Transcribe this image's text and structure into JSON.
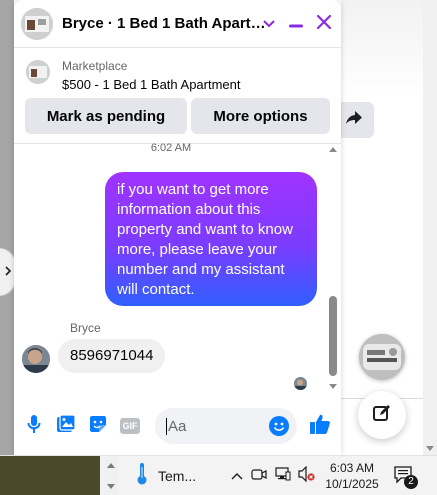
{
  "chat_window": {
    "header": {
      "title": "Bryce · 1 Bed 1 Bath Apart…",
      "icons": [
        "chevron-down-icon",
        "minimize-icon",
        "close-icon"
      ]
    },
    "marketplace": {
      "label": "Marketplace",
      "listing_title": "$500 - 1 Bed 1 Bath Apartment"
    },
    "actions": {
      "mark_pending_label": "Mark as pending",
      "more_options_label": "More options"
    },
    "timestamp": "6:02 AM",
    "messages": [
      {
        "direction": "outgoing",
        "text": "if you want to get more information about this property and want to know more, please leave your number and my assistant will contact."
      },
      {
        "direction": "incoming",
        "sender": "Bryce",
        "text": "8596971044"
      }
    ],
    "composer": {
      "placeholder": "Aa",
      "icons": [
        "microphone-icon",
        "photo-icon",
        "sticker-icon",
        "gif-icon",
        "emoji-icon",
        "thumbs-up-icon"
      ],
      "gif_label": "GIF"
    },
    "colors": {
      "accent": "#0a7cff",
      "header_icons": "#8a2be2",
      "bubble_gradient_top": "#a033ff",
      "bubble_gradient_bottom": "#2f5fff"
    }
  },
  "taskbar": {
    "weather_label": "Tem...",
    "time": "6:03 AM",
    "date": "10/1/2025",
    "notification_count": "2",
    "tray_icons": [
      "chevron-up-icon",
      "meet-now-icon",
      "network-icon",
      "volume-muted-icon"
    ]
  }
}
